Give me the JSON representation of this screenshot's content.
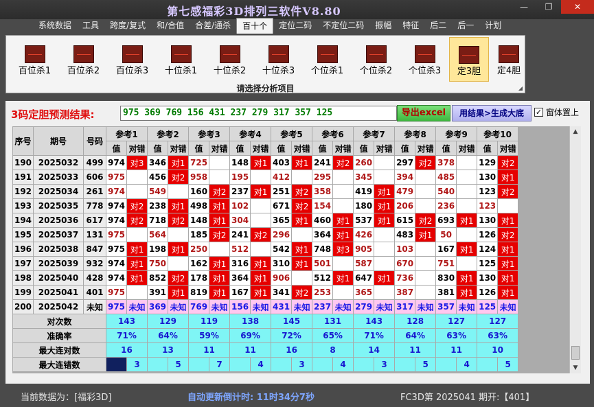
{
  "app": {
    "title": "第七感福彩3D排列三软件V8.80"
  },
  "window_buttons": {
    "minimize": "—",
    "maximize": "❐",
    "close": "✕"
  },
  "menu": [
    "系统数据",
    "工具",
    "跨度/复式",
    "和/合值",
    "合差/通杀",
    "百十个",
    "定位二码",
    "不定位二码",
    "振幅",
    "特征",
    "后二",
    "后一",
    "计划"
  ],
  "active_menu": "百十个",
  "ribbon": {
    "items": [
      "百位杀1",
      "百位杀2",
      "百位杀3",
      "十位杀1",
      "十位杀2",
      "十位杀3",
      "个位杀1",
      "个位杀2",
      "个位杀3",
      "定3胆",
      "定4胆"
    ],
    "selected": "定3胆",
    "caption": "请选择分析项目",
    "icon": "chart-icon"
  },
  "prediction": {
    "label": "3码定胆预测结果:",
    "numbers": "975 369 769 156 431 237 279 317 357 125",
    "export_button": "导出excel",
    "generate_button": "用结果>生成大底",
    "checkbox_label": "窗体置上",
    "checkbox_checked": "✓"
  },
  "table": {
    "headers": {
      "seq": "序号",
      "period": "期号",
      "number": "号码"
    },
    "ref_groups": [
      "参考1",
      "参考2",
      "参考3",
      "参考4",
      "参考5",
      "参考6",
      "参考7",
      "参考8",
      "参考9",
      "参考10"
    ],
    "sub_headers": {
      "value": "值",
      "result": "对错"
    },
    "rows": [
      {
        "seq": "190",
        "period": "2025032",
        "number": "499",
        "cells": [
          [
            "974",
            "对3"
          ],
          [
            "346",
            "对1"
          ],
          [
            "725",
            ""
          ],
          [
            "148",
            "对1"
          ],
          [
            "403",
            "对1"
          ],
          [
            "241",
            "对2"
          ],
          [
            "260",
            ""
          ],
          [
            "297",
            "对2"
          ],
          [
            "378",
            ""
          ],
          [
            "129",
            "对2"
          ]
        ]
      },
      {
        "seq": "191",
        "period": "2025033",
        "number": "606",
        "cells": [
          [
            "975",
            ""
          ],
          [
            "456",
            "对2"
          ],
          [
            "958",
            ""
          ],
          [
            "195",
            ""
          ],
          [
            "412",
            ""
          ],
          [
            "295",
            ""
          ],
          [
            "345",
            ""
          ],
          [
            "394",
            ""
          ],
          [
            "485",
            ""
          ],
          [
            "130",
            "对1"
          ]
        ]
      },
      {
        "seq": "192",
        "period": "2025034",
        "number": "261",
        "cells": [
          [
            "974",
            ""
          ],
          [
            "549",
            ""
          ],
          [
            "160",
            "对2"
          ],
          [
            "237",
            "对1"
          ],
          [
            "251",
            "对2"
          ],
          [
            "358",
            ""
          ],
          [
            "419",
            "对1"
          ],
          [
            "479",
            ""
          ],
          [
            "540",
            ""
          ],
          [
            "123",
            "对2"
          ]
        ]
      },
      {
        "seq": "193",
        "period": "2025035",
        "number": "778",
        "cells": [
          [
            "974",
            "对2"
          ],
          [
            "238",
            "对1"
          ],
          [
            "498",
            "对1"
          ],
          [
            "102",
            ""
          ],
          [
            "671",
            "对2"
          ],
          [
            "154",
            ""
          ],
          [
            "180",
            "对1"
          ],
          [
            "206",
            ""
          ],
          [
            "236",
            ""
          ],
          [
            "123",
            ""
          ]
        ]
      },
      {
        "seq": "194",
        "period": "2025036",
        "number": "617",
        "cells": [
          [
            "974",
            "对2"
          ],
          [
            "718",
            "对2"
          ],
          [
            "148",
            "对1"
          ],
          [
            "304",
            ""
          ],
          [
            "365",
            "对1"
          ],
          [
            "460",
            "对1"
          ],
          [
            "537",
            "对1"
          ],
          [
            "615",
            "对2"
          ],
          [
            "693",
            "对1"
          ],
          [
            "130",
            "对1"
          ]
        ]
      },
      {
        "seq": "195",
        "period": "2025037",
        "number": "131",
        "cells": [
          [
            "975",
            ""
          ],
          [
            "564",
            ""
          ],
          [
            "185",
            "对2"
          ],
          [
            "241",
            "对2"
          ],
          [
            "296",
            ""
          ],
          [
            "364",
            "对1"
          ],
          [
            "426",
            ""
          ],
          [
            "483",
            "对1"
          ],
          [
            "50",
            ""
          ],
          [
            "126",
            "对2"
          ]
        ]
      },
      {
        "seq": "196",
        "period": "2025038",
        "number": "847",
        "cells": [
          [
            "975",
            "对1"
          ],
          [
            "198",
            "对1"
          ],
          [
            "250",
            ""
          ],
          [
            "512",
            ""
          ],
          [
            "542",
            "对1"
          ],
          [
            "748",
            "对3"
          ],
          [
            "905",
            ""
          ],
          [
            "103",
            ""
          ],
          [
            "167",
            "对1"
          ],
          [
            "124",
            "对1"
          ]
        ]
      },
      {
        "seq": "197",
        "period": "2025039",
        "number": "932",
        "cells": [
          [
            "974",
            "对1"
          ],
          [
            "750",
            ""
          ],
          [
            "162",
            "对1"
          ],
          [
            "316",
            "对1"
          ],
          [
            "310",
            "对1"
          ],
          [
            "501",
            ""
          ],
          [
            "587",
            ""
          ],
          [
            "670",
            ""
          ],
          [
            "751",
            ""
          ],
          [
            "125",
            "对1"
          ]
        ]
      },
      {
        "seq": "198",
        "period": "2025040",
        "number": "428",
        "cells": [
          [
            "974",
            "对1"
          ],
          [
            "852",
            "对2"
          ],
          [
            "178",
            "对1"
          ],
          [
            "364",
            "对1"
          ],
          [
            "906",
            ""
          ],
          [
            "512",
            "对1"
          ],
          [
            "647",
            "对1"
          ],
          [
            "736",
            ""
          ],
          [
            "830",
            "对1"
          ],
          [
            "130",
            "对1"
          ]
        ]
      },
      {
        "seq": "199",
        "period": "2025041",
        "number": "401",
        "cells": [
          [
            "975",
            ""
          ],
          [
            "391",
            "对1"
          ],
          [
            "819",
            "对1"
          ],
          [
            "167",
            "对1"
          ],
          [
            "341",
            "对2"
          ],
          [
            "253",
            ""
          ],
          [
            "365",
            ""
          ],
          [
            "387",
            ""
          ],
          [
            "381",
            "对1"
          ],
          [
            "126",
            "对1"
          ]
        ]
      }
    ],
    "prediction_row": {
      "seq": "200",
      "period": "2025042",
      "number": "未知",
      "cells": [
        [
          "975",
          "未知"
        ],
        [
          "369",
          "未知"
        ],
        [
          "769",
          "未知"
        ],
        [
          "156",
          "未知"
        ],
        [
          "431",
          "未知"
        ],
        [
          "237",
          "未知"
        ],
        [
          "279",
          "未知"
        ],
        [
          "317",
          "未知"
        ],
        [
          "357",
          "未知"
        ],
        [
          "125",
          "未知"
        ]
      ]
    },
    "stats": [
      {
        "label": "对次数",
        "values": [
          "143",
          "129",
          "119",
          "138",
          "145",
          "131",
          "143",
          "128",
          "127",
          "127"
        ]
      },
      {
        "label": "准确率",
        "values": [
          "71%",
          "64%",
          "59%",
          "69%",
          "72%",
          "65%",
          "71%",
          "64%",
          "63%",
          "63%"
        ]
      },
      {
        "label": "最大连对数",
        "values": [
          "16",
          "13",
          "11",
          "11",
          "16",
          "8",
          "14",
          "11",
          "11",
          "10"
        ]
      },
      {
        "label": "最大连错数",
        "values": [
          "3",
          "5",
          "7",
          "4",
          "3",
          "4",
          "3",
          "5",
          "4",
          "5"
        ]
      }
    ]
  },
  "status": {
    "current_data": "当前数据为：[福彩3D]",
    "countdown": "自动更新倒计时:  11时34分7秒",
    "period_info": "FC3D第 2025041 期开:【401】"
  },
  "colors": {
    "hit_red": "#e60000",
    "miss_text": "#b01818",
    "prediction_pink": "#ffc8f0",
    "stat_cyan": "#7ff5f5",
    "ribbon_selected": "#ffe79a"
  }
}
